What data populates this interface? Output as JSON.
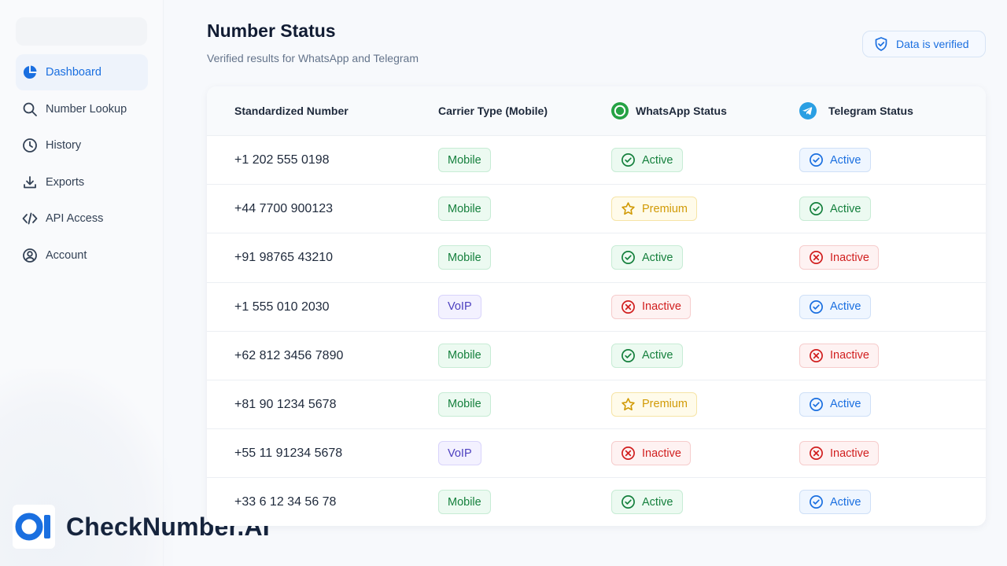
{
  "sidebar": {
    "items": [
      {
        "label": "Dashboard",
        "icon": "pie-chart-icon",
        "active": true
      },
      {
        "label": "Number Lookup",
        "icon": "search-icon"
      },
      {
        "label": "History",
        "icon": "clock-icon"
      },
      {
        "label": "Exports",
        "icon": "download-icon"
      },
      {
        "label": "API Access",
        "icon": "code-icon"
      },
      {
        "label": "Account",
        "icon": "user-circle-icon"
      }
    ]
  },
  "brand": {
    "name": "CheckNumber.AI",
    "logo_icon": "ai-logo-icon"
  },
  "header": {
    "title": "Number Status",
    "subtitle": "Verified results for WhatsApp and Telegram",
    "verified_label": "Data is verified",
    "verified_icon": "shield-check-icon"
  },
  "table": {
    "columns": [
      "Standardized Number",
      "Carrier Type (Mobile)",
      "WhatsApp Status",
      "Telegram Status"
    ],
    "rows": [
      {
        "number": "+1 202 555 0198",
        "carrier": "Mobile",
        "whatsapp": "Active",
        "telegram": "Active"
      },
      {
        "number": "+44 7700 900123",
        "carrier": "Mobile",
        "whatsapp": "Premium",
        "telegram": "Active"
      },
      {
        "number": "+91 98765 43210",
        "carrier": "Mobile",
        "whatsapp": "Active",
        "telegram": "Inactive"
      },
      {
        "number": "+1 555 010 2030",
        "carrier": "VoIP",
        "whatsapp": "Inactive",
        "telegram": "Active"
      },
      {
        "number": "+62 812 3456 7890",
        "carrier": "Mobile",
        "whatsapp": "Active",
        "telegram": "Inactive"
      },
      {
        "number": "+81 90 1234 5678",
        "carrier": "Mobile",
        "whatsapp": "Premium",
        "telegram": "Active"
      },
      {
        "number": "+55 11 91234 5678",
        "carrier": "VoIP",
        "whatsapp": "Inactive",
        "telegram": "Inactive"
      },
      {
        "number": "+33 6 12 34 56 78",
        "carrier": "Mobile",
        "whatsapp": "Active",
        "telegram": "Active"
      }
    ]
  },
  "colors": {
    "accent": "#1a6fe0",
    "active_green": "#15803d",
    "premium_amber": "#d19a06",
    "inactive_red": "#d11f1f",
    "voip_purple": "#4c3fbf",
    "whatsapp_green": "#25a244",
    "telegram_blue": "#2a9fe3"
  }
}
